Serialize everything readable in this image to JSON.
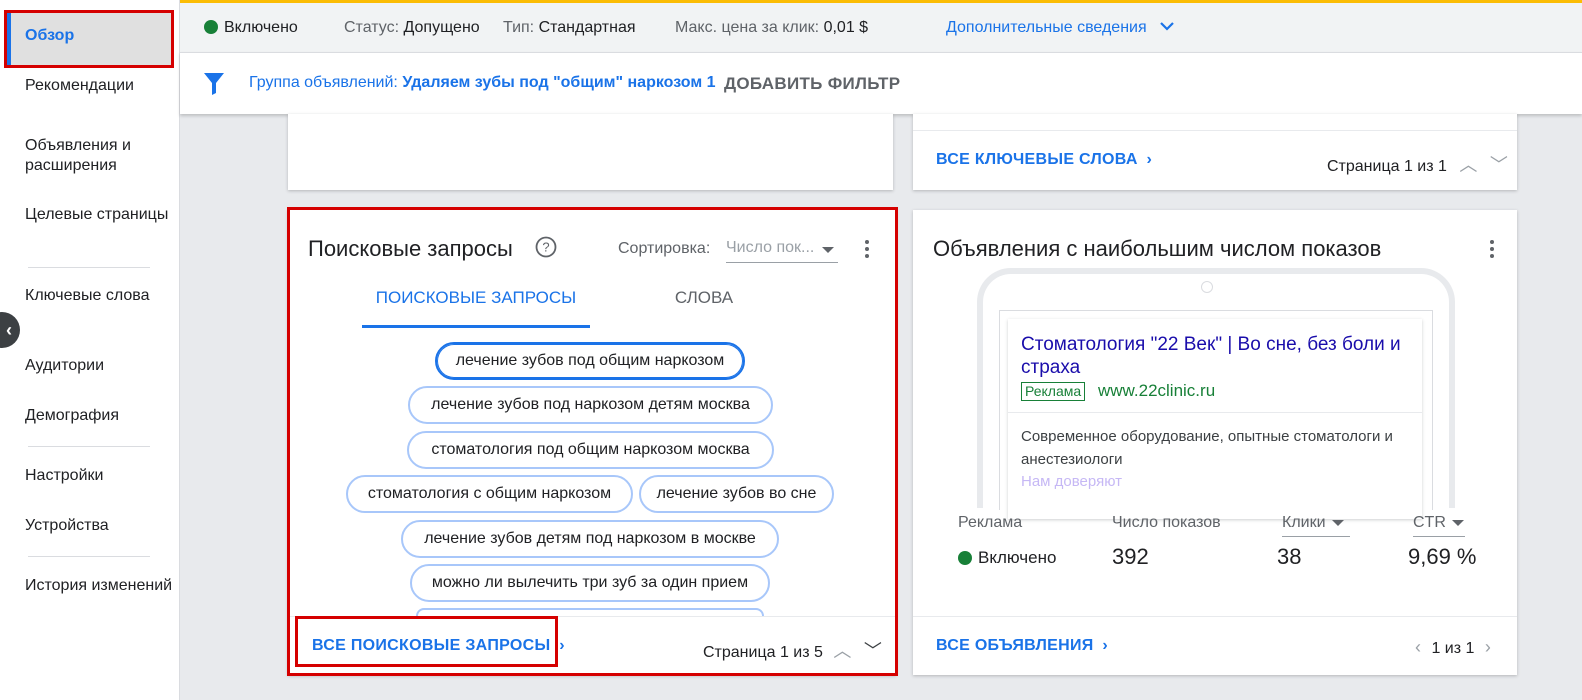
{
  "sidebar": {
    "active": "Обзор",
    "items": [
      "Рекомендации",
      "Объявления и расширения",
      "Целевые страницы",
      "Ключевые слова",
      "Аудитории",
      "Демография",
      "Настройки",
      "Устройства",
      "История изменений"
    ]
  },
  "topbar": {
    "status_enabled": "Включено",
    "status_label": "Статус:",
    "status_value": "Допущено",
    "type_label": "Тип:",
    "type_value": "Стандартная",
    "maxcpc_label": "Макс. цена за клик:",
    "maxcpc_value": "0,01 $",
    "more_info": "Дополнительные сведения"
  },
  "filterbar": {
    "group_label": "Группа объявлений:",
    "group_value": "Удаляем зубы под \"общим\" наркозом 1",
    "add_filter": "ДОБАВИТЬ ФИЛЬТР"
  },
  "keywords_card": {
    "link": "ВСЕ КЛЮЧЕВЫЕ СЛОВА",
    "pager": "Страница 1 из 1"
  },
  "search_card": {
    "title": "Поисковые запросы",
    "sort_label": "Сортировка:",
    "sort_value": "Число пок...",
    "tabs": [
      "ПОИСКОВЫЕ ЗАПРОСЫ",
      "СЛОВА"
    ],
    "chips": [
      "лечение зубов под общим наркозом",
      "лечение зубов под наркозом детям москва",
      "стоматология под общим наркозом москва",
      "стоматология с общим наркозом",
      "лечение зубов во сне",
      "лечение зубов детям под наркозом в москве",
      "можно ли вылечить три зуб за один прием"
    ],
    "link": "ВСЕ ПОИСКОВЫЕ ЗАПРОСЫ",
    "pager": "Страница 1 из 5"
  },
  "ads_card": {
    "title": "Объявления с наибольшим числом показов",
    "ad_title": "Стоматология \"22 Век\" | Во сне, без боли и страха",
    "ad_badge": "Реклама",
    "ad_url": "www.22clinic.ru",
    "ad_desc": "Современное оборудование, опытные стоматологи и анестезиологи",
    "ad_extra": "Нам доверяют",
    "stats": {
      "col_ad": "Реклама",
      "col_impr": "Число показов",
      "col_clicks": "Клики",
      "col_ctr": "CTR",
      "status": "Включено",
      "impr": "392",
      "clicks": "38",
      "ctr": "9,69 %"
    },
    "link": "ВСЕ ОБЪЯВЛЕНИЯ",
    "pager": "1 из 1"
  },
  "colors": {
    "accent": "#1a73e8",
    "highlight": "#d50000",
    "enabled": "#188038"
  }
}
